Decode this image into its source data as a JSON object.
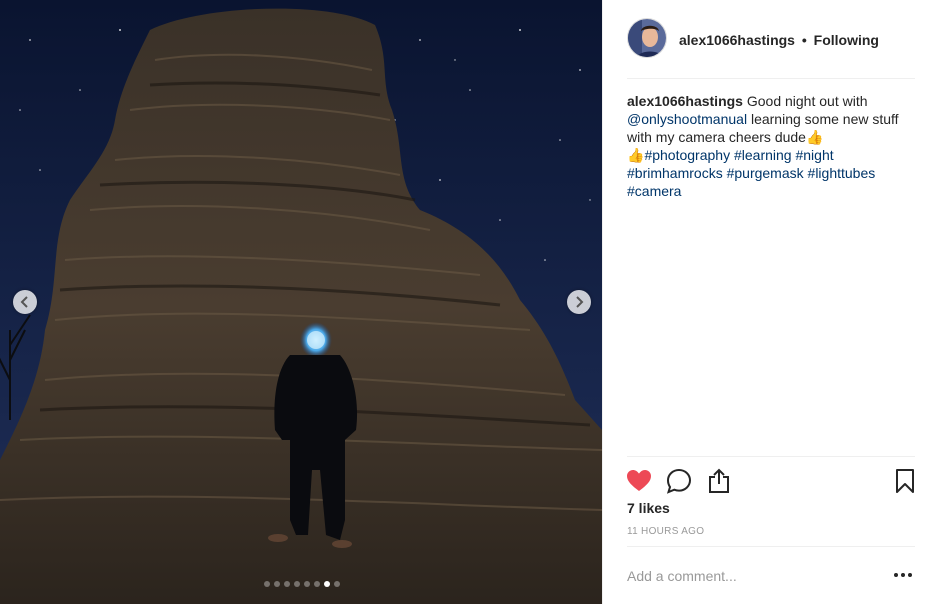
{
  "post": {
    "author": {
      "username": "alex1066hastings",
      "follow_state": "Following",
      "separator": "•"
    },
    "caption": {
      "username": "alex1066hastings",
      "text_1": " Good night out with ",
      "mention": "@onlyshootmanual",
      "text_2": " learning some new stuff with my camera cheers dude",
      "emoji_1": "👍",
      "emoji_2": "👍",
      "hashtags": [
        "#photography",
        "#learning",
        "#night",
        "#brimhamrocks",
        "#purgemask",
        "#lighttubes",
        "#camera"
      ]
    },
    "likes": "7 likes",
    "timestamp": "11 HOURS AGO",
    "comment": {
      "placeholder": "Add a comment..."
    },
    "carousel": {
      "slide_count": 8,
      "active_index": 6
    }
  },
  "icons": {
    "like": "heart-icon",
    "comment": "comment-icon",
    "share": "share-icon",
    "save": "bookmark-icon",
    "prev": "chevron-left-icon",
    "next": "chevron-right-icon",
    "more": "more-options-icon"
  },
  "colors": {
    "like_red": "#ed4956",
    "link_blue": "#003569",
    "text": "#262626",
    "muted": "#999999"
  }
}
